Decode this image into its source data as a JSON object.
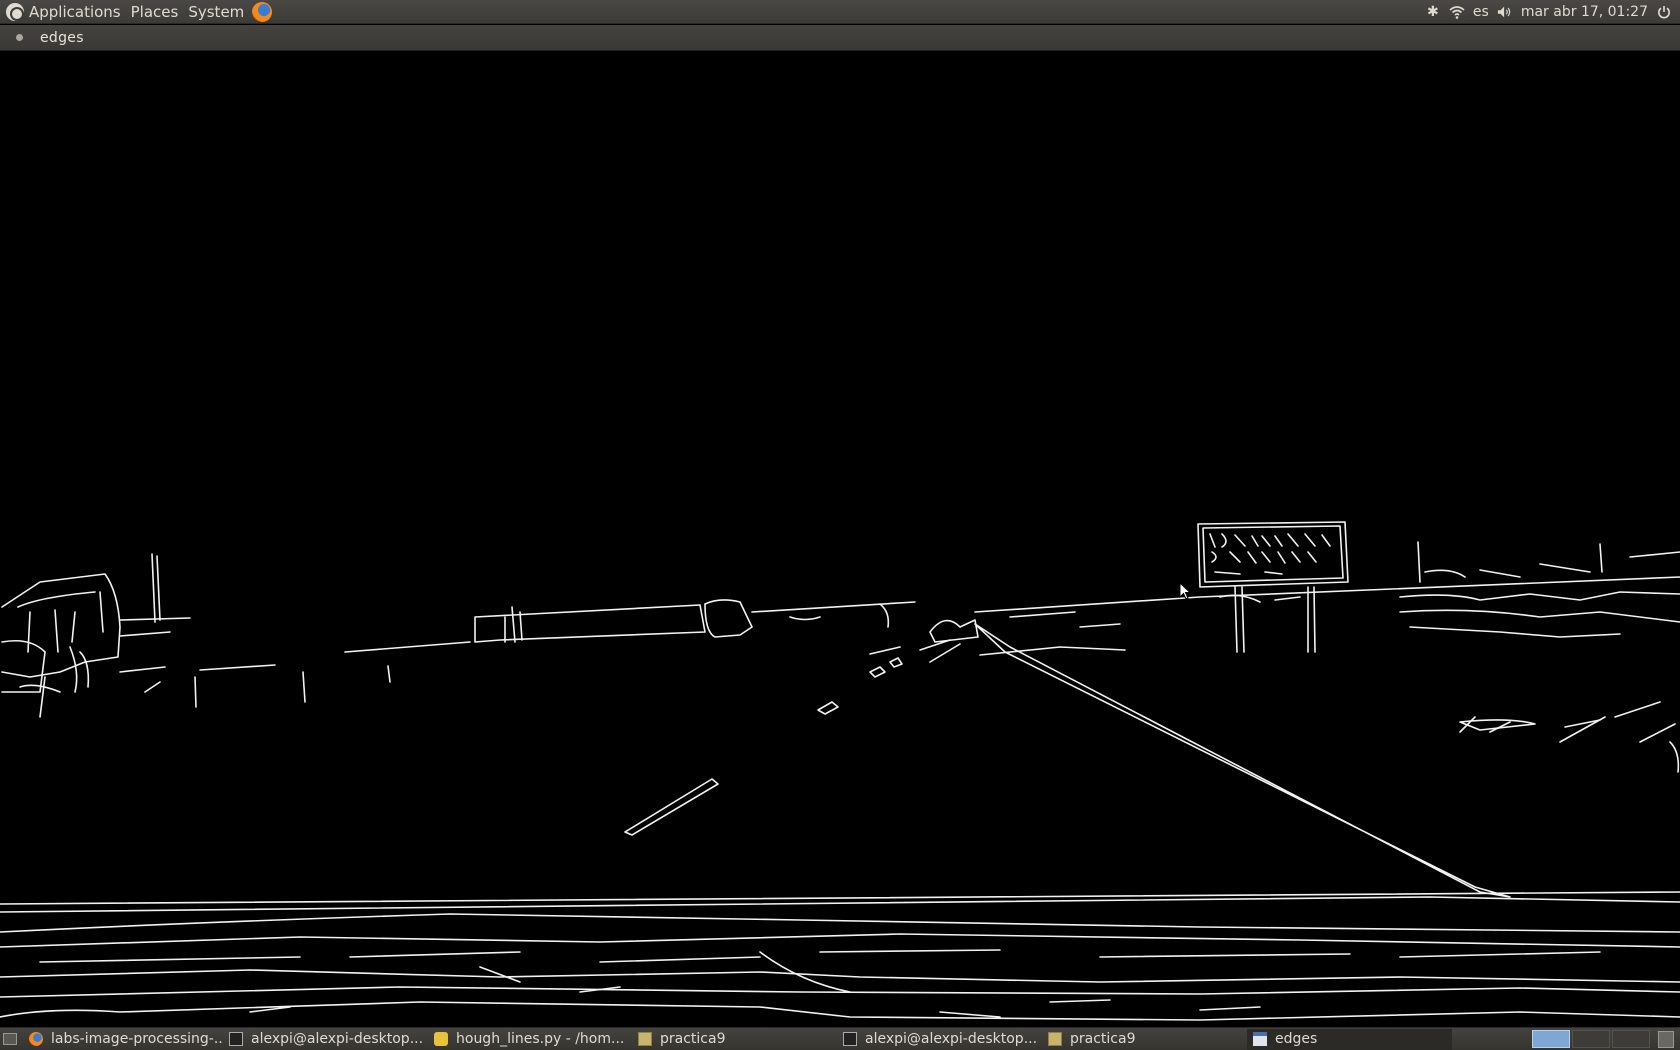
{
  "top_panel": {
    "menus": [
      "Applications",
      "Places",
      "System"
    ],
    "keyboard_layout": "es",
    "clock": "mar abr 17, 01:27"
  },
  "window": {
    "title": "edges"
  },
  "taskbar": {
    "tasks": [
      {
        "label": "labs-image-processing-...",
        "icon": "firefox-icon"
      },
      {
        "label": "alexpi@alexpi-desktop...",
        "icon": "terminal-icon"
      },
      {
        "label": "hough_lines.py - /hom...",
        "icon": "gedit-icon"
      },
      {
        "label": "practica9",
        "icon": "folder-icon"
      },
      {
        "label": "alexpi@alexpi-desktop...",
        "icon": "terminal-icon"
      },
      {
        "label": "practica9",
        "icon": "folder-icon"
      },
      {
        "label": "edges",
        "icon": "window-icon"
      }
    ]
  },
  "image": {
    "content": "canny edge detection output of a road scene",
    "sign_text": "LOW CLEARANCE 3 MILES AHEAD"
  }
}
